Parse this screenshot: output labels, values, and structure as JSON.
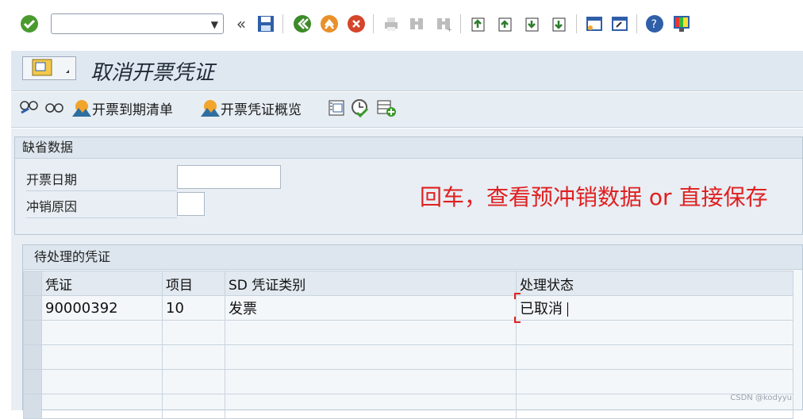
{
  "toolbar": {
    "command_field_value": "",
    "icons": [
      "enter-check-icon",
      "back-icon",
      "save-icon",
      "back-green-icon",
      "exit-icon",
      "cancel-icon",
      "print-icon",
      "find-icon",
      "find-next-icon",
      "first-page-icon",
      "prev-page-icon",
      "next-page-icon",
      "last-page-icon",
      "new-session-icon",
      "shortcut-icon",
      "help-icon",
      "customize-layout-icon"
    ]
  },
  "title": "取消开票凭证",
  "app_toolbar": {
    "item1": "开票到期清单",
    "item2": "开票凭证概览"
  },
  "defaults": {
    "header": "缺省数据",
    "billing_date_label": "开票日期",
    "billing_date_value": "",
    "cancel_reason_label": "冲销原因",
    "cancel_reason_value": ""
  },
  "annotation": "回车，查看预冲销数据 or 直接保存",
  "docs": {
    "header": "待处理的凭证",
    "columns": [
      "凭证",
      "项目",
      "SD 凭证类别",
      "处理状态"
    ],
    "rows": [
      [
        "90000392",
        "10",
        "发票",
        "已取消"
      ]
    ]
  },
  "watermark": "CSDN @kodyyu"
}
